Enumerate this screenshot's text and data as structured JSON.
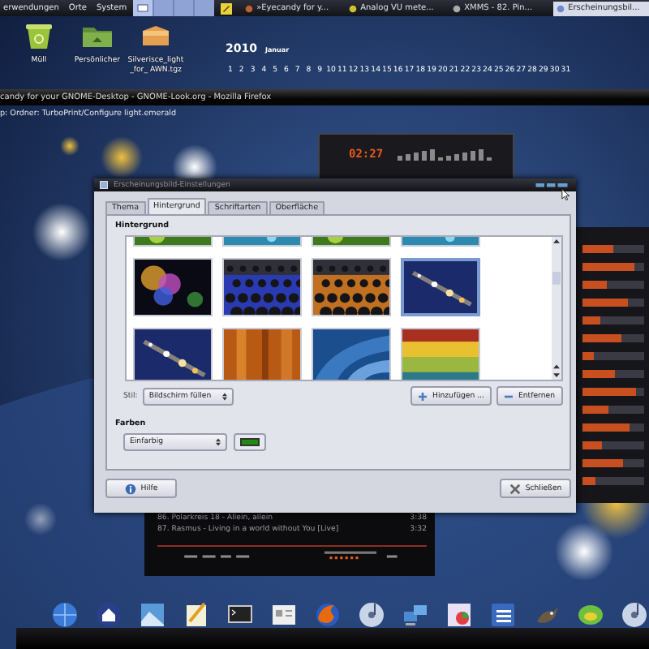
{
  "top_panel": {
    "menus": [
      "erwendungen",
      "Orte",
      "System"
    ],
    "tasks": [
      {
        "label": "»Eyecandy for y...",
        "selected": false
      },
      {
        "label": "Analog VU mete...",
        "selected": false
      },
      {
        "label": "XMMS - 82. Pin...",
        "selected": false
      },
      {
        "label": "Erscheinungsbil...",
        "selected": true
      }
    ]
  },
  "desktop_icons": [
    {
      "kind": "trash",
      "label": "Müll"
    },
    {
      "kind": "folder",
      "label": "Persönlicher"
    },
    {
      "kind": "package",
      "label": "Silverisce_light_for_ AWN.tgz"
    }
  ],
  "calendar": {
    "year": "2010",
    "month": "Januar",
    "days": [
      "1",
      "2",
      "3",
      "4",
      "5",
      "6",
      "7",
      "8",
      "9",
      "10",
      "11",
      "12",
      "13",
      "14",
      "15",
      "16",
      "17",
      "18",
      "19",
      "20",
      "21",
      "22",
      "23",
      "24",
      "25",
      "26",
      "27",
      "28",
      "29",
      "30",
      "31"
    ]
  },
  "browser_title": "candy for your GNOME-Desktop - GNOME-Look.org - Mozilla Firefox",
  "file_path": "p: Ordner: TurboPrint/Configure light.emerald",
  "player": {
    "time": "02:27",
    "tracks": [
      {
        "title": "86. Polarkreis 18 - Allein, allein",
        "duration": "3:38"
      },
      {
        "title": "87. Rasmus - Living in a world without You [Live]",
        "duration": "3:32"
      }
    ]
  },
  "dialog": {
    "title": "Erscheinungsbild-Einstellungen",
    "tabs": [
      {
        "label": "Thema",
        "selected": false
      },
      {
        "label": "Hintergrund",
        "selected": true
      },
      {
        "label": "Schriftarten",
        "selected": false
      },
      {
        "label": "Oberfläche",
        "selected": false
      }
    ],
    "section": "Hintergrund",
    "wallpapers": [
      {
        "kind": "picture",
        "selected": false
      },
      {
        "kind": "picture",
        "selected": false
      },
      {
        "kind": "picture",
        "selected": false
      },
      {
        "kind": "picture",
        "selected": false
      },
      {
        "kind": "picture",
        "selected": false
      },
      {
        "kind": "picture",
        "selected": false
      },
      {
        "kind": "picture",
        "selected": false
      },
      {
        "kind": "picture",
        "selected": true
      },
      {
        "kind": "picture",
        "selected": false
      },
      {
        "kind": "picture",
        "selected": false
      },
      {
        "kind": "picture",
        "selected": false
      },
      {
        "kind": "picture",
        "selected": false
      }
    ],
    "style_label": "Stil:",
    "style_value": "Bildschirm füllen",
    "add_button": "Hinzufügen ...",
    "remove_button": "Entfernen",
    "colors_label": "Farben",
    "color_mode": "Einfarbig",
    "color": "#1e8c12",
    "help_button": "Hilfe",
    "close_button": "Schließen"
  }
}
